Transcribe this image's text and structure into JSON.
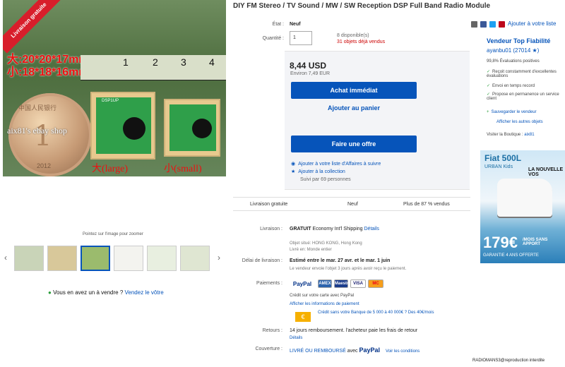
{
  "gallery": {
    "ribbon": "Livraison gratuite",
    "size_large": "大:20*20*17mm",
    "size_small": "小:18*18*16mm",
    "ruler_numbers": [
      "1",
      "2",
      "3",
      "4"
    ],
    "watermark": "aix81's ebay shop",
    "coin_text": "中国人民银行",
    "coin_year": "2012",
    "label_large": "大(large)",
    "label_small": "小(small)",
    "chip_label": "DSP1UP",
    "zoom_hint": "Pointez sur l'image pour zoomer",
    "arrow_left": "‹",
    "arrow_right": "›",
    "sell_question": "Vous en avez un à vendre ?",
    "sell_link": "Vendez le vôtre"
  },
  "listing": {
    "title": "DIY FM Stereo / TV Sound / MW / SW Reception DSP Full Band Radio Module",
    "condition_label": "État :",
    "condition_value": "Neuf",
    "quantity_label": "Quantité :",
    "quantity_value": "1",
    "available": "8 disponible(s)",
    "sold": "31 objets déjà vendus",
    "price": "8,44 USD",
    "price_conv": "Environ 7,49 EUR",
    "buy_now": "Achat immédiat",
    "add_cart": "Ajouter au panier",
    "make_offer": "Faire une offre",
    "watchlist": "Ajouter à votre liste d'Affaires à suivre",
    "collection": "Ajouter à la collection",
    "watchers": "Suivi par 69 personnes",
    "share_label": "Ajouter à votre liste"
  },
  "stats": {
    "shipping": "Livraison gratuite",
    "condition": "Neuf",
    "sold_pct": "Plus de 87 % vendus"
  },
  "details": {
    "delivery_label": "Livraison :",
    "delivery_value": "GRATUIT",
    "delivery_method": "Economy Int'l Shipping",
    "delivery_detail": "Détails",
    "delivery_sub1": "Objet situé: HONG KONG, Hong Kong",
    "delivery_sub2": "Livré en: Monde entier",
    "delay_label": "Délai de livraison :",
    "delay_value": "Estimé entre le mar. 27 avr. et le mar. 1 juin",
    "delay_sub": "Le vendeur envoie l'objet 3 jours après avoir reçu le paiement.",
    "payment_label": "Paiements :",
    "payment_sub": "Crédit sur votre carte avec PayPal",
    "payment_link": "Afficher les informations de paiement",
    "credit_text": "Crédit sans votre Banque de 5 000 à 40 000€ ? Des 40€/mois",
    "returns_label": "Retours :",
    "returns_value": "14 jours remboursement. l'acheteur paie les frais de retour",
    "returns_detail": "Détails",
    "coverage_label": "Couverture :",
    "coverage_value": "LIVRÉ OU REMBOURSÉ",
    "coverage_with": "avec",
    "coverage_paypal": "PayPal",
    "coverage_cond": "Voir les conditions"
  },
  "payment_logos": [
    "PayPal",
    "VISA",
    "MC",
    "AMEX",
    "Maestro"
  ],
  "seller": {
    "title": "Vendeur Top Fiabilité",
    "name": "ayanbu01 (27014 ★)",
    "feedback": "99,8% Évaluations positives",
    "perks": [
      "Reçoit constamment d'excellentes évaluations",
      "Envoi en temps record",
      "Propose en permanence un service client"
    ],
    "follow": "Sauvegarder le vendeur",
    "other_items": "Afficher les autres objets",
    "store_label": "Visiter la Boutique :",
    "store_name": "aix81"
  },
  "ad": {
    "brand": "Fiat 500L",
    "brand_sub": "URBAN Kids",
    "headline": "LA NOUVELLE VOS",
    "price": "179€",
    "price_sub": "/MOIS SANS APPORT",
    "guarantee": "GARANTIE 4 ANS OFFERTE"
  },
  "footer": {
    "copyright": "RADIOMANS3@reproduction interdite"
  },
  "colors": {
    "primary_blue": "#0654ba",
    "ribbon_red": "#d81e2b",
    "check_green": "#2a9d3a"
  }
}
